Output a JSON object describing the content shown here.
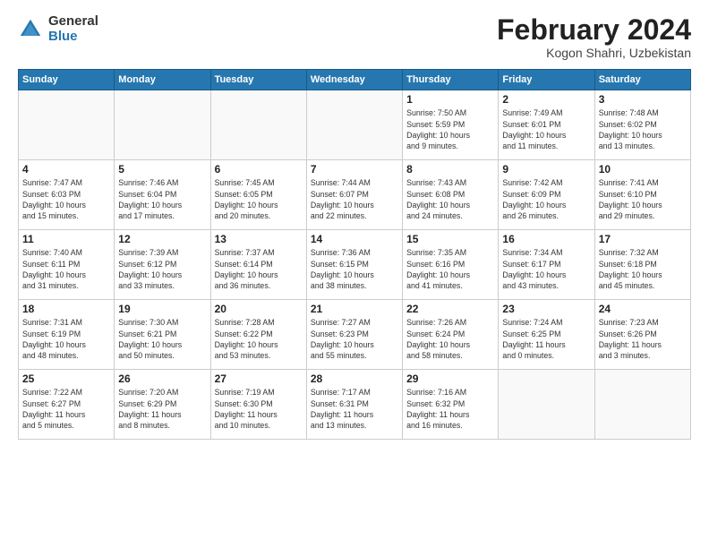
{
  "header": {
    "logo_general": "General",
    "logo_blue": "Blue",
    "month_title": "February 2024",
    "location": "Kogon Shahri, Uzbekistan"
  },
  "weekdays": [
    "Sunday",
    "Monday",
    "Tuesday",
    "Wednesday",
    "Thursday",
    "Friday",
    "Saturday"
  ],
  "weeks": [
    [
      {
        "day": "",
        "info": ""
      },
      {
        "day": "",
        "info": ""
      },
      {
        "day": "",
        "info": ""
      },
      {
        "day": "",
        "info": ""
      },
      {
        "day": "1",
        "info": "Sunrise: 7:50 AM\nSunset: 5:59 PM\nDaylight: 10 hours\nand 9 minutes."
      },
      {
        "day": "2",
        "info": "Sunrise: 7:49 AM\nSunset: 6:01 PM\nDaylight: 10 hours\nand 11 minutes."
      },
      {
        "day": "3",
        "info": "Sunrise: 7:48 AM\nSunset: 6:02 PM\nDaylight: 10 hours\nand 13 minutes."
      }
    ],
    [
      {
        "day": "4",
        "info": "Sunrise: 7:47 AM\nSunset: 6:03 PM\nDaylight: 10 hours\nand 15 minutes."
      },
      {
        "day": "5",
        "info": "Sunrise: 7:46 AM\nSunset: 6:04 PM\nDaylight: 10 hours\nand 17 minutes."
      },
      {
        "day": "6",
        "info": "Sunrise: 7:45 AM\nSunset: 6:05 PM\nDaylight: 10 hours\nand 20 minutes."
      },
      {
        "day": "7",
        "info": "Sunrise: 7:44 AM\nSunset: 6:07 PM\nDaylight: 10 hours\nand 22 minutes."
      },
      {
        "day": "8",
        "info": "Sunrise: 7:43 AM\nSunset: 6:08 PM\nDaylight: 10 hours\nand 24 minutes."
      },
      {
        "day": "9",
        "info": "Sunrise: 7:42 AM\nSunset: 6:09 PM\nDaylight: 10 hours\nand 26 minutes."
      },
      {
        "day": "10",
        "info": "Sunrise: 7:41 AM\nSunset: 6:10 PM\nDaylight: 10 hours\nand 29 minutes."
      }
    ],
    [
      {
        "day": "11",
        "info": "Sunrise: 7:40 AM\nSunset: 6:11 PM\nDaylight: 10 hours\nand 31 minutes."
      },
      {
        "day": "12",
        "info": "Sunrise: 7:39 AM\nSunset: 6:12 PM\nDaylight: 10 hours\nand 33 minutes."
      },
      {
        "day": "13",
        "info": "Sunrise: 7:37 AM\nSunset: 6:14 PM\nDaylight: 10 hours\nand 36 minutes."
      },
      {
        "day": "14",
        "info": "Sunrise: 7:36 AM\nSunset: 6:15 PM\nDaylight: 10 hours\nand 38 minutes."
      },
      {
        "day": "15",
        "info": "Sunrise: 7:35 AM\nSunset: 6:16 PM\nDaylight: 10 hours\nand 41 minutes."
      },
      {
        "day": "16",
        "info": "Sunrise: 7:34 AM\nSunset: 6:17 PM\nDaylight: 10 hours\nand 43 minutes."
      },
      {
        "day": "17",
        "info": "Sunrise: 7:32 AM\nSunset: 6:18 PM\nDaylight: 10 hours\nand 45 minutes."
      }
    ],
    [
      {
        "day": "18",
        "info": "Sunrise: 7:31 AM\nSunset: 6:19 PM\nDaylight: 10 hours\nand 48 minutes."
      },
      {
        "day": "19",
        "info": "Sunrise: 7:30 AM\nSunset: 6:21 PM\nDaylight: 10 hours\nand 50 minutes."
      },
      {
        "day": "20",
        "info": "Sunrise: 7:28 AM\nSunset: 6:22 PM\nDaylight: 10 hours\nand 53 minutes."
      },
      {
        "day": "21",
        "info": "Sunrise: 7:27 AM\nSunset: 6:23 PM\nDaylight: 10 hours\nand 55 minutes."
      },
      {
        "day": "22",
        "info": "Sunrise: 7:26 AM\nSunset: 6:24 PM\nDaylight: 10 hours\nand 58 minutes."
      },
      {
        "day": "23",
        "info": "Sunrise: 7:24 AM\nSunset: 6:25 PM\nDaylight: 11 hours\nand 0 minutes."
      },
      {
        "day": "24",
        "info": "Sunrise: 7:23 AM\nSunset: 6:26 PM\nDaylight: 11 hours\nand 3 minutes."
      }
    ],
    [
      {
        "day": "25",
        "info": "Sunrise: 7:22 AM\nSunset: 6:27 PM\nDaylight: 11 hours\nand 5 minutes."
      },
      {
        "day": "26",
        "info": "Sunrise: 7:20 AM\nSunset: 6:29 PM\nDaylight: 11 hours\nand 8 minutes."
      },
      {
        "day": "27",
        "info": "Sunrise: 7:19 AM\nSunset: 6:30 PM\nDaylight: 11 hours\nand 10 minutes."
      },
      {
        "day": "28",
        "info": "Sunrise: 7:17 AM\nSunset: 6:31 PM\nDaylight: 11 hours\nand 13 minutes."
      },
      {
        "day": "29",
        "info": "Sunrise: 7:16 AM\nSunset: 6:32 PM\nDaylight: 11 hours\nand 16 minutes."
      },
      {
        "day": "",
        "info": ""
      },
      {
        "day": "",
        "info": ""
      }
    ]
  ]
}
